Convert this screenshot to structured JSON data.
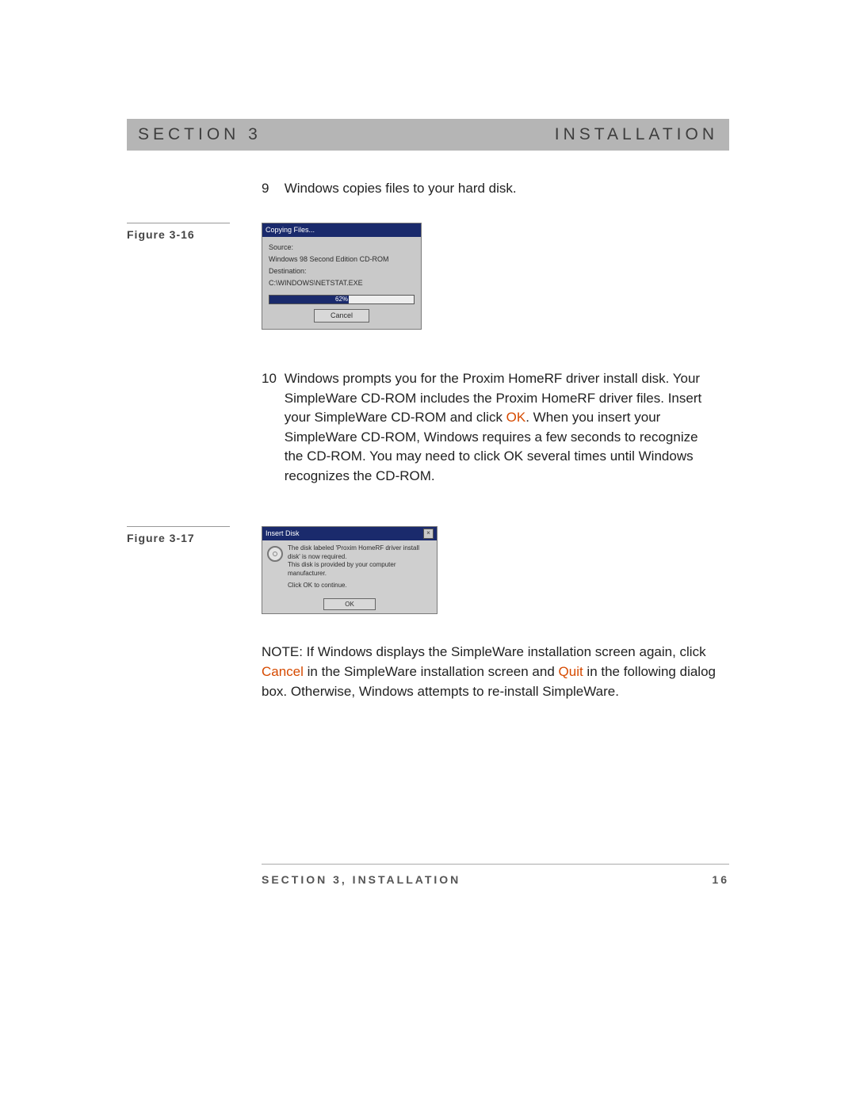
{
  "header": {
    "left": "SECTION 3",
    "right": "INSTALLATION"
  },
  "steps": {
    "s9": {
      "num": "9",
      "text": "Windows copies files to your hard disk."
    },
    "s10": {
      "num": "10",
      "pre": "Windows prompts you for the Proxim HomeRF driver install disk. Your SimpleWare CD-ROM includes the Proxim HomeRF driver files.  Insert your SimpleWare CD-ROM and click ",
      "ok": "OK",
      "post": ". When you insert your SimpleWare CD-ROM, Windows requires a few seconds to recognize the CD-ROM. You may need to click OK several times until Windows recognizes the CD-ROM."
    }
  },
  "captions": {
    "fig16": "Figure 3-16",
    "fig17": "Figure 3-17"
  },
  "fig16": {
    "title": "Copying Files...",
    "source_label": "Source:",
    "source_value": "Windows 98 Second Edition CD-ROM",
    "dest_label": "Destination:",
    "dest_value": "C:\\WINDOWS\\NETSTAT.EXE",
    "percent": "62%",
    "cancel": "Cancel"
  },
  "fig17": {
    "title": "Insert Disk",
    "line1": "The disk labeled 'Proxim HomeRF driver install disk' is now required.",
    "line2": "This disk is provided by your computer manufacturer.",
    "line3": "Click OK to continue.",
    "ok": "OK"
  },
  "note": {
    "lead": "NOTE:  If Windows displays the SimpleWare installation screen again, click ",
    "cancel": "Cancel",
    "mid": " in the SimpleWare installation screen and ",
    "quit": "Quit",
    "tail": " in the following dialog box.  Otherwise, Windows attempts to re-install SimpleWare."
  },
  "footer": {
    "section": "SECTION 3, INSTALLATION",
    "page": "16"
  }
}
